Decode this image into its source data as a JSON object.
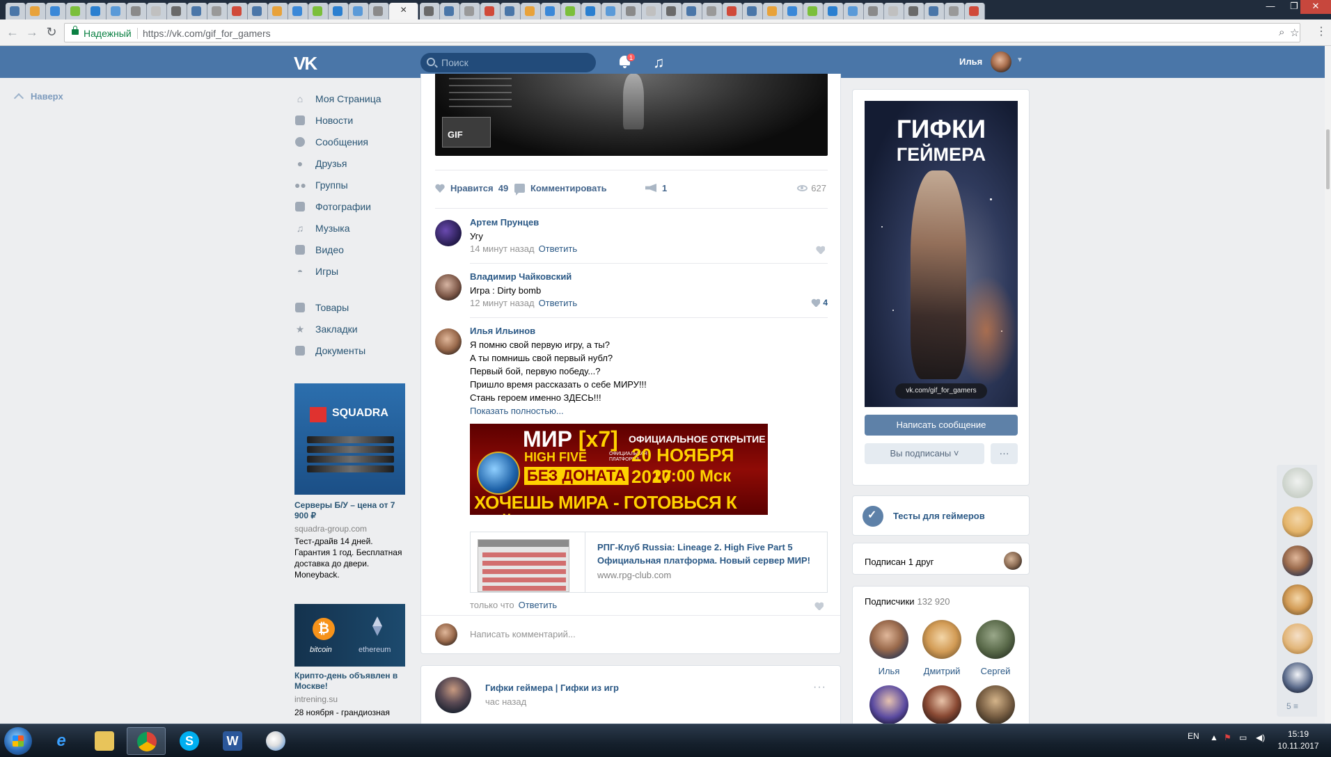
{
  "browser": {
    "active_tab_close": "×",
    "window_controls": [
      "—",
      "❐",
      "✕"
    ],
    "secure_label": "Надежный",
    "url": "https://vk.com/gif_for_gamers"
  },
  "header": {
    "logo": "VK",
    "search_placeholder": "Поиск",
    "notifications_count": "1",
    "music_icon": "♫",
    "user_name": "Илья"
  },
  "back_to_top": "Наверх",
  "leftnav": {
    "items": [
      {
        "label": "Моя Страница",
        "icon": "home-icon"
      },
      {
        "label": "Новости",
        "icon": "news-icon"
      },
      {
        "label": "Сообщения",
        "icon": "messages-icon"
      },
      {
        "label": "Друзья",
        "icon": "friends-icon"
      },
      {
        "label": "Группы",
        "icon": "groups-icon"
      },
      {
        "label": "Фотографии",
        "icon": "camera-icon"
      },
      {
        "label": "Музыка",
        "icon": "music-icon"
      },
      {
        "label": "Видео",
        "icon": "video-icon"
      },
      {
        "label": "Игры",
        "icon": "gamepad-icon"
      },
      {
        "label": "Товары",
        "icon": "bag-icon"
      },
      {
        "label": "Закладки",
        "icon": "star-icon"
      },
      {
        "label": "Документы",
        "icon": "document-icon"
      }
    ]
  },
  "ads": [
    {
      "brand": "SQUADRA",
      "title": "Серверы Б/У – цена от 7 900 ₽",
      "domain": "squadra-group.com",
      "text": "Тест-драйв 14 дней. Гарантия 1 год. Бесплатная доставка до двери. Moneyback."
    },
    {
      "brand_left": "bitcoin",
      "brand_right": "ethereum",
      "title": "Крипто-день объявлен в Москве!",
      "domain": "intrening.su",
      "text": "28 ноября - грандиозная"
    }
  ],
  "post": {
    "gif_label": "GIF",
    "actions": {
      "like_label": "Нравится",
      "like_count": "49",
      "comment_label": "Комментировать",
      "share_count": "1",
      "views": "627"
    },
    "comments": [
      {
        "author": "Артем Прунцев",
        "text": "Угу",
        "time": "14 минут назад",
        "reply": "Ответить",
        "likes": ""
      },
      {
        "author": "Владимир Чайковский",
        "text": "Игра : Dirty bomb",
        "time": "12 минут назад",
        "reply": "Ответить",
        "likes": "4"
      },
      {
        "author": "Илья Ильинов",
        "lines": [
          "Я помню свой первую игру, а ты?",
          "А ты помнишь свой первый нубл?",
          "Первый бой, первую победу...?",
          "Пришло время рассказать о себе МИРУ!!!",
          "Стань героем именно ЗДЕСЬ!!!"
        ],
        "show_more": "Показать полностью...",
        "time": "только что",
        "reply": "Ответить"
      }
    ],
    "promo": {
      "title": "МИР",
      "title_x": "[x7]",
      "server": "HIGH FIVE",
      "server_sub": "ОФИЦИАЛЬНАЯ ПЛАТФОРМА",
      "no_donate": "БЕЗ ДОНАТА",
      "opening": "ОФИЦИАЛЬНОЕ ОТКРЫТИЕ",
      "date": "20 НОЯБРЯ 2017",
      "time": "20:00 Мск",
      "slogan": "ХОЧЕШЬ МИРА - ГОТОВЬСЯ К ВОЙНЕ"
    },
    "link": {
      "title": "РПГ-Клуб Russia: Lineage 2. High Five Part 5 Официальная платформа. Новый сервер МИР!",
      "domain": "www.rpg-club.com"
    },
    "write_comment_placeholder": "Написать комментарий..."
  },
  "post2": {
    "name": "Гифки геймера | Гифки из игр",
    "time": "час назад",
    "menu": "···"
  },
  "community": {
    "cover_title_1": "ГИФКИ",
    "cover_title_2": "ГЕЙМЕРА",
    "cover_url": "vk.com/gif_for_gamers",
    "write_message": "Написать сообщение",
    "subscribed": "Вы подписаны ˅",
    "more": "···",
    "app_name": "Тесты для геймеров",
    "friends_subscribed": "Подписан 1 друг",
    "subscribers_label": "Подписчики",
    "subscribers_count": "132 920",
    "subscribers": [
      {
        "name": "Илья"
      },
      {
        "name": "Дмитрий"
      },
      {
        "name": "Сергей"
      }
    ]
  },
  "floatbar": {
    "more_count": "5"
  },
  "taskbar": {
    "lang": "EN",
    "time": "15:19",
    "date": "10.11.2017"
  }
}
